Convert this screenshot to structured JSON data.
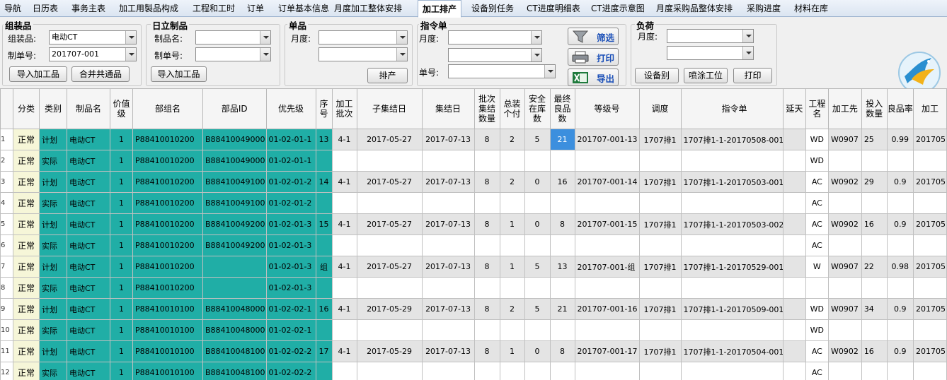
{
  "tabs": [
    {
      "label": "导航"
    },
    {
      "label": "日历表"
    },
    {
      "label": "事务主表"
    },
    {
      "label": "加工用製品构成"
    },
    {
      "label": "工程和工时"
    },
    {
      "label": "订单"
    },
    {
      "label": "订单基本信息"
    },
    {
      "label": "月度加工整体安排"
    },
    {
      "label": "加工排产"
    },
    {
      "label": "设备别任务"
    },
    {
      "label": "CT进度明细表"
    },
    {
      "label": "CT进度示意图"
    },
    {
      "label": "月度采购品整体安排"
    },
    {
      "label": "采购进度"
    },
    {
      "label": "材料在库"
    }
  ],
  "active_tab": "加工排产",
  "assembly": {
    "title": "组装品",
    "product_label": "组装品:",
    "product_value": "电动CT",
    "order_label": "制单号:",
    "order_value": "201707-001",
    "import_button": "导入加工品",
    "merge_button": "合并共通品"
  },
  "hitachi": {
    "title": "日立制品",
    "product_label": "制品名:",
    "order_label": "制单号:",
    "import_button": "导入加工品"
  },
  "single": {
    "title": "单品",
    "month_label": "月度:",
    "schedule_button": "排产"
  },
  "command": {
    "title": "指令单",
    "month_label": "月度:",
    "no_label": "单号:",
    "filter_label": "筛选",
    "print_label": "打印",
    "export_label": "导出"
  },
  "load": {
    "title": "负荷",
    "month_label": "月度:",
    "device_button": "设备别",
    "paint_button": "喷涂工位",
    "print_button": "打印"
  },
  "columns_left": [
    "",
    "分类",
    "类别",
    "制品名",
    "价值级",
    "部组名",
    "部品ID",
    "优先级",
    "序号",
    "加工批次",
    "子集结日",
    "集结日",
    "批次集结数量",
    "总装个付",
    "安全在库数",
    "最终良品数",
    "等级号",
    "调度",
    "指令单"
  ],
  "columns_right": [
    "延天",
    "工程名",
    "加工先",
    "投入数量",
    "良品率",
    "加工"
  ],
  "rows": [
    {
      "n": "1",
      "cat": "正常",
      "type": "计划",
      "name": "电动CT",
      "lvl": "1",
      "part_group": "P88410010200",
      "part_id": "B88410049000",
      "prio": "01-02-01-1",
      "seq": "13",
      "batch": "4-1",
      "sub_date": "2017-05-27",
      "date": "2017-07-13",
      "qty": "8",
      "asm": "2",
      "safe": "5",
      "good": "21",
      "grade": "201707-001-13",
      "sched": "1707排1",
      "order": "1707排1-1-20170508-001",
      "delay": "",
      "proc": "WD",
      "vendor": "W0907",
      "input": "25",
      "rate": "0.99",
      "proc_date": "201705"
    },
    {
      "n": "2",
      "cat": "正常",
      "type": "实际",
      "name": "电动CT",
      "lvl": "1",
      "part_group": "P88410010200",
      "part_id": "B88410049000",
      "prio": "01-02-01-1",
      "seq": "",
      "batch": "",
      "sub_date": "",
      "date": "",
      "qty": "",
      "asm": "",
      "safe": "",
      "good": "",
      "grade": "",
      "sched": "",
      "order": "",
      "delay": "",
      "proc": "WD",
      "vendor": "",
      "input": "",
      "rate": "",
      "proc_date": ""
    },
    {
      "n": "3",
      "cat": "正常",
      "type": "计划",
      "name": "电动CT",
      "lvl": "1",
      "part_group": "P88410010200",
      "part_id": "B88410049100",
      "prio": "01-02-01-2",
      "seq": "14",
      "batch": "4-1",
      "sub_date": "2017-05-27",
      "date": "2017-07-13",
      "qty": "8",
      "asm": "2",
      "safe": "0",
      "good": "16",
      "grade": "201707-001-14",
      "sched": "1707排1",
      "order": "1707排1-1-20170503-001",
      "delay": "",
      "proc": "AC",
      "vendor": "W0902",
      "input": "29",
      "rate": "0.9",
      "proc_date": "201705"
    },
    {
      "n": "4",
      "cat": "正常",
      "type": "实际",
      "name": "电动CT",
      "lvl": "1",
      "part_group": "P88410010200",
      "part_id": "B88410049100",
      "prio": "01-02-01-2",
      "seq": "",
      "batch": "",
      "sub_date": "",
      "date": "",
      "qty": "",
      "asm": "",
      "safe": "",
      "good": "",
      "grade": "",
      "sched": "",
      "order": "",
      "delay": "",
      "proc": "AC",
      "vendor": "",
      "input": "",
      "rate": "",
      "proc_date": ""
    },
    {
      "n": "5",
      "cat": "正常",
      "type": "计划",
      "name": "电动CT",
      "lvl": "1",
      "part_group": "P88410010200",
      "part_id": "B88410049200",
      "prio": "01-02-01-3",
      "seq": "15",
      "batch": "4-1",
      "sub_date": "2017-05-27",
      "date": "2017-07-13",
      "qty": "8",
      "asm": "1",
      "safe": "0",
      "good": "8",
      "grade": "201707-001-15",
      "sched": "1707排1",
      "order": "1707排1-1-20170503-002",
      "delay": "",
      "proc": "AC",
      "vendor": "W0902",
      "input": "16",
      "rate": "0.9",
      "proc_date": "201705"
    },
    {
      "n": "6",
      "cat": "正常",
      "type": "实际",
      "name": "电动CT",
      "lvl": "1",
      "part_group": "P88410010200",
      "part_id": "B88410049200",
      "prio": "01-02-01-3",
      "seq": "",
      "batch": "",
      "sub_date": "",
      "date": "",
      "qty": "",
      "asm": "",
      "safe": "",
      "good": "",
      "grade": "",
      "sched": "",
      "order": "",
      "delay": "",
      "proc": "AC",
      "vendor": "",
      "input": "",
      "rate": "",
      "proc_date": ""
    },
    {
      "n": "7",
      "cat": "正常",
      "type": "计划",
      "name": "电动CT",
      "lvl": "1",
      "part_group": "P88410010200",
      "part_id": "",
      "prio": "01-02-01-3",
      "seq": "组",
      "batch": "4-1",
      "sub_date": "2017-05-27",
      "date": "2017-07-13",
      "qty": "8",
      "asm": "1",
      "safe": "5",
      "good": "13",
      "grade": "201707-001-组",
      "sched": "1707排1",
      "order": "1707排1-1-20170529-001",
      "delay": "",
      "proc": "W",
      "vendor": "W0907",
      "input": "22",
      "rate": "0.98",
      "proc_date": "201705"
    },
    {
      "n": "8",
      "cat": "正常",
      "type": "实际",
      "name": "电动CT",
      "lvl": "1",
      "part_group": "P88410010200",
      "part_id": "",
      "prio": "01-02-01-3",
      "seq": "",
      "batch": "",
      "sub_date": "",
      "date": "",
      "qty": "",
      "asm": "",
      "safe": "",
      "good": "",
      "grade": "",
      "sched": "",
      "order": "",
      "delay": "",
      "proc": "",
      "vendor": "",
      "input": "",
      "rate": "",
      "proc_date": ""
    },
    {
      "n": "9",
      "cat": "正常",
      "type": "计划",
      "name": "电动CT",
      "lvl": "1",
      "part_group": "P88410010100",
      "part_id": "B88410048000",
      "prio": "01-02-02-1",
      "seq": "16",
      "batch": "4-1",
      "sub_date": "2017-05-29",
      "date": "2017-07-13",
      "qty": "8",
      "asm": "2",
      "safe": "5",
      "good": "21",
      "grade": "201707-001-16",
      "sched": "1707排1",
      "order": "1707排1-1-20170509-001",
      "delay": "",
      "proc": "WD",
      "vendor": "W0907",
      "input": "34",
      "rate": "0.9",
      "proc_date": "201705"
    },
    {
      "n": "10",
      "cat": "正常",
      "type": "实际",
      "name": "电动CT",
      "lvl": "1",
      "part_group": "P88410010100",
      "part_id": "B88410048000",
      "prio": "01-02-02-1",
      "seq": "",
      "batch": "",
      "sub_date": "",
      "date": "",
      "qty": "",
      "asm": "",
      "safe": "",
      "good": "",
      "grade": "",
      "sched": "",
      "order": "",
      "delay": "",
      "proc": "WD",
      "vendor": "",
      "input": "",
      "rate": "",
      "proc_date": ""
    },
    {
      "n": "11",
      "cat": "正常",
      "type": "计划",
      "name": "电动CT",
      "lvl": "1",
      "part_group": "P88410010100",
      "part_id": "B88410048100",
      "prio": "01-02-02-2",
      "seq": "17",
      "batch": "4-1",
      "sub_date": "2017-05-29",
      "date": "2017-07-13",
      "qty": "8",
      "asm": "1",
      "safe": "0",
      "good": "8",
      "grade": "201707-001-17",
      "sched": "1707排1",
      "order": "1707排1-1-20170504-001",
      "delay": "",
      "proc": "AC",
      "vendor": "W0902",
      "input": "16",
      "rate": "0.9",
      "proc_date": "201705"
    },
    {
      "n": "12",
      "cat": "正常",
      "type": "实际",
      "name": "电动CT",
      "lvl": "1",
      "part_group": "P88410010100",
      "part_id": "B88410048100",
      "prio": "01-02-02-2",
      "seq": "",
      "batch": "",
      "sub_date": "",
      "date": "",
      "qty": "",
      "asm": "",
      "safe": "",
      "good": "",
      "grade": "",
      "sched": "",
      "order": "",
      "delay": "",
      "proc": "AC",
      "vendor": "",
      "input": "",
      "rate": "",
      "proc_date": ""
    }
  ],
  "selected_cell": {
    "row": 0,
    "col": "good"
  },
  "colors": {
    "cyan": "#20aea6",
    "grey_row": "#e4e4e4",
    "selected": "#3c8fde",
    "header_bg": "#f5f5f5"
  }
}
